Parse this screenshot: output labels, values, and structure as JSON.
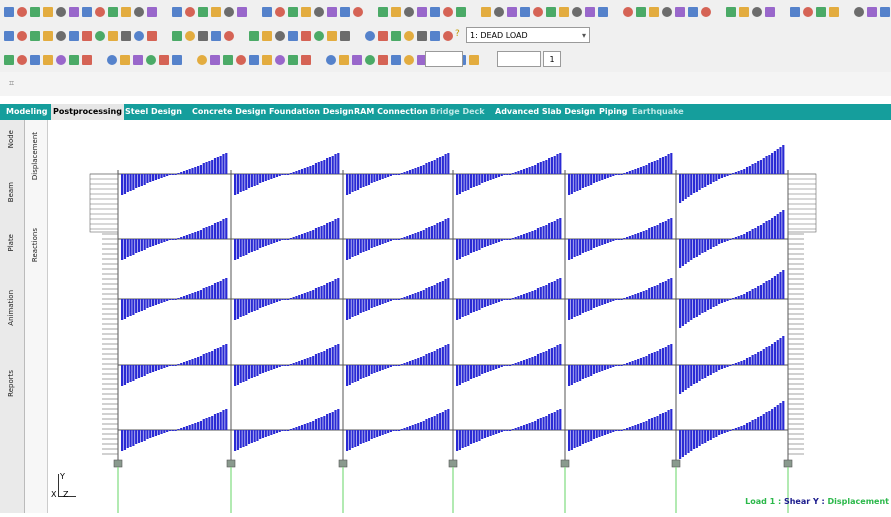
{
  "toolbar": {
    "load_case_icon": "help-question-icon",
    "load_case_value": "1: DEAD LOAD",
    "scale_value": "",
    "spin_value": "1"
  },
  "tabs": [
    {
      "label": "Modeling",
      "active": false
    },
    {
      "label": "Postprocessing",
      "active": true
    },
    {
      "label": "Steel Design",
      "active": false
    },
    {
      "label": "Concrete Design",
      "active": false
    },
    {
      "label": "Foundation Design",
      "active": false
    },
    {
      "label": "RAM Connection",
      "active": false
    },
    {
      "label": "Bridge Deck",
      "active": false,
      "dim": true
    },
    {
      "label": "Advanced Slab Design",
      "active": false
    },
    {
      "label": "Piping",
      "active": false
    },
    {
      "label": "Earthquake",
      "active": false,
      "dim": true
    }
  ],
  "left_tabs": [
    "Node",
    "Beam",
    "Plate",
    "Animation",
    "Reports"
  ],
  "page_tabs": [
    "Displacement",
    "Reactions"
  ],
  "axis": {
    "y": "Y",
    "x": "X",
    "z": "Z"
  },
  "status": {
    "prefix": "Load 1 : ",
    "main": "Shear Y : ",
    "suffix": "Displacement"
  },
  "colors": {
    "diagram": "#2a2ad4",
    "tabbar": "#159e9c",
    "status_green": "#2bb84a",
    "status_blue": "#1a1a8c",
    "support": "#8a9a8e",
    "ground_line": "#7fdc7f"
  },
  "frame": {
    "bays": 6,
    "stories": 5
  }
}
